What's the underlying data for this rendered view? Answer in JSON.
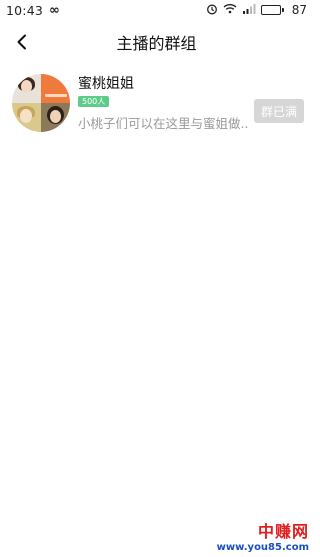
{
  "status_bar": {
    "time": "10:43",
    "link_symbol": "∞",
    "battery": "87",
    "battery_level": 0.87
  },
  "header": {
    "title": "主播的群组"
  },
  "groups": [
    {
      "name": "蜜桃姐姐",
      "badge": "500人",
      "description": "小桃子们可以在这里与蜜姐做...",
      "action_label": "群已满"
    }
  ],
  "watermark": {
    "title": "中赚网",
    "url": "www.you85.com"
  },
  "colors": {
    "badge": "#5dcc8a",
    "button_disabled": "#d6d6d6",
    "watermark_red": "#e02020",
    "watermark_blue": "#1a4fbf"
  }
}
